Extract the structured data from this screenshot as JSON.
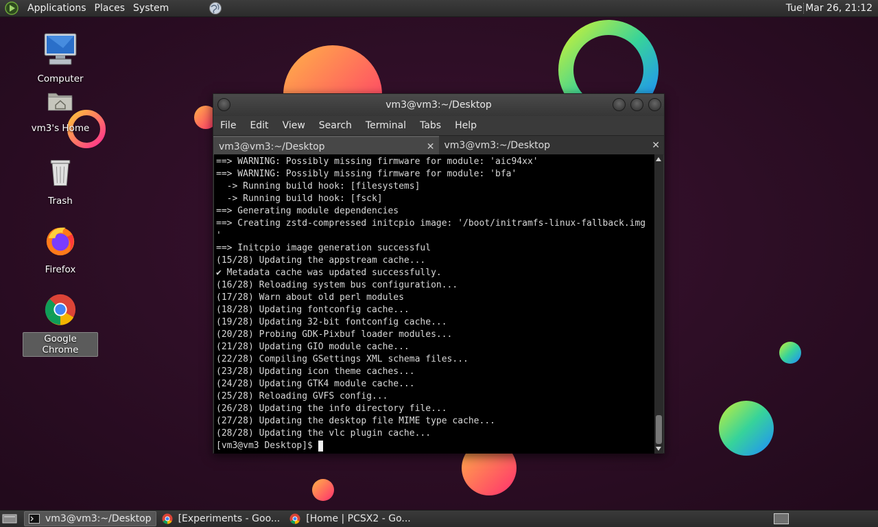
{
  "top_panel": {
    "menus": [
      "Applications",
      "Places",
      "System"
    ],
    "clock": "Tue Mar 26, 21:12"
  },
  "desktop_icons": [
    {
      "label": "Computer",
      "icon": "computer-icon"
    },
    {
      "label": "vm3's Home",
      "icon": "home-folder-icon"
    },
    {
      "label": "Trash",
      "icon": "trash-icon"
    },
    {
      "label": "Firefox",
      "icon": "firefox-icon"
    },
    {
      "label": "Google Chrome",
      "icon": "chrome-icon",
      "selected": true
    }
  ],
  "terminal": {
    "title": "vm3@vm3:~/Desktop",
    "menu": [
      "File",
      "Edit",
      "View",
      "Search",
      "Terminal",
      "Tabs",
      "Help"
    ],
    "tabs": [
      {
        "label": "vm3@vm3:~/Desktop",
        "active": true
      },
      {
        "label": "vm3@vm3:~/Desktop",
        "active": false
      }
    ],
    "lines": [
      "==> WARNING: Possibly missing firmware for module: 'aic94xx'",
      "==> WARNING: Possibly missing firmware for module: 'bfa'",
      "  -> Running build hook: [filesystems]",
      "  -> Running build hook: [fsck]",
      "==> Generating module dependencies",
      "==> Creating zstd-compressed initcpio image: '/boot/initramfs-linux-fallback.img",
      "'",
      "==> Initcpio image generation successful",
      "(15/28) Updating the appstream cache...",
      "✔ Metadata cache was updated successfully.",
      "(16/28) Reloading system bus configuration...",
      "(17/28) Warn about old perl modules",
      "(18/28) Updating fontconfig cache...",
      "(19/28) Updating 32-bit fontconfig cache...",
      "(20/28) Probing GDK-Pixbuf loader modules...",
      "(21/28) Updating GIO module cache...",
      "(22/28) Compiling GSettings XML schema files...",
      "(23/28) Updating icon theme caches...",
      "(24/28) Updating GTK4 module cache...",
      "(25/28) Reloading GVFS config...",
      "(26/28) Updating the info directory file...",
      "(27/28) Updating the desktop file MIME type cache...",
      "(28/28) Updating the vlc plugin cache..."
    ],
    "prompt": "[vm3@vm3 Desktop]$"
  },
  "taskbar": {
    "tasks": [
      {
        "label": "vm3@vm3:~/Desktop",
        "icon": "terminal-icon",
        "active": true
      },
      {
        "label": "[Experiments - Goo...",
        "icon": "chrome-icon",
        "active": false
      },
      {
        "label": "[Home | PCSX2 - Go...",
        "icon": "chrome-icon",
        "active": false
      }
    ]
  },
  "colors": {
    "wallpaper": "#2a0d23",
    "terminal_bg": "#000000",
    "terminal_fg": "#d8d8d8",
    "panel": "#333333"
  }
}
